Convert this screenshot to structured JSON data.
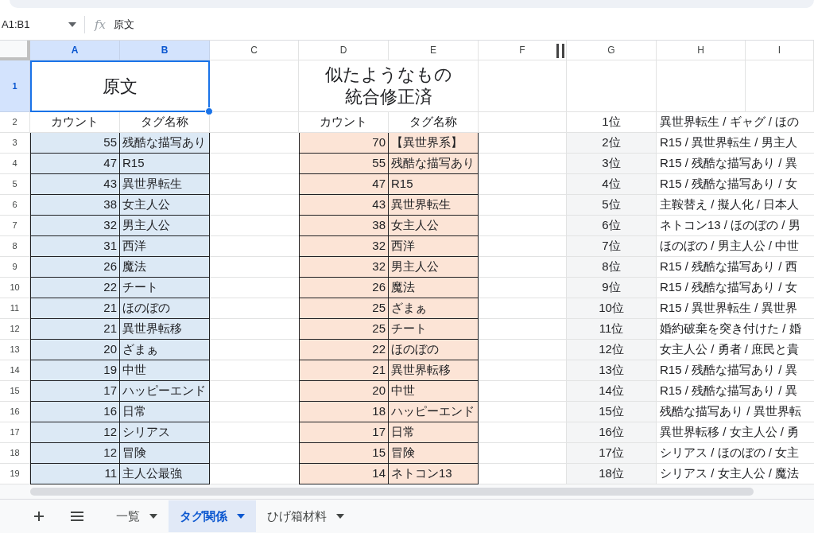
{
  "name_box": "A1:B1",
  "function_label": "fx",
  "formula": "原文",
  "columns": [
    {
      "label": "A",
      "selected": true
    },
    {
      "label": "B",
      "selected": true
    },
    {
      "label": "C",
      "selected": false
    },
    {
      "label": "D",
      "selected": false
    },
    {
      "label": "E",
      "selected": false
    },
    {
      "label": "F",
      "selected": false
    },
    {
      "label": "G",
      "selected": false
    },
    {
      "label": "H",
      "selected": false
    },
    {
      "label": "I",
      "selected": false
    }
  ],
  "row_numbers": [
    {
      "number": "1",
      "selected": true
    },
    {
      "number": "2",
      "selected": false
    },
    {
      "number": "3",
      "selected": false
    },
    {
      "number": "4",
      "selected": false
    },
    {
      "number": "5",
      "selected": false
    },
    {
      "number": "6",
      "selected": false
    },
    {
      "number": "7",
      "selected": false
    },
    {
      "number": "8",
      "selected": false
    },
    {
      "number": "9",
      "selected": false
    },
    {
      "number": "10",
      "selected": false
    },
    {
      "number": "11",
      "selected": false
    },
    {
      "number": "12",
      "selected": false
    },
    {
      "number": "13",
      "selected": false
    },
    {
      "number": "14",
      "selected": false
    },
    {
      "number": "15",
      "selected": false
    },
    {
      "number": "16",
      "selected": false
    },
    {
      "number": "17",
      "selected": false
    },
    {
      "number": "18",
      "selected": false
    },
    {
      "number": "19",
      "selected": false
    }
  ],
  "left_table": {
    "title": "原文",
    "headers": [
      "カウント",
      "タグ名称"
    ],
    "rows": [
      {
        "count": "55",
        "tag": "残酷な描写あり"
      },
      {
        "count": "47",
        "tag": "R15"
      },
      {
        "count": "43",
        "tag": "異世界転生"
      },
      {
        "count": "38",
        "tag": "女主人公"
      },
      {
        "count": "32",
        "tag": "男主人公"
      },
      {
        "count": "31",
        "tag": "西洋"
      },
      {
        "count": "26",
        "tag": "魔法"
      },
      {
        "count": "22",
        "tag": "チート"
      },
      {
        "count": "21",
        "tag": "ほのぼの"
      },
      {
        "count": "21",
        "tag": "異世界転移"
      },
      {
        "count": "20",
        "tag": "ざまぁ"
      },
      {
        "count": "19",
        "tag": "中世"
      },
      {
        "count": "17",
        "tag": "ハッピーエンド"
      },
      {
        "count": "16",
        "tag": "日常"
      },
      {
        "count": "12",
        "tag": "シリアス"
      },
      {
        "count": "12",
        "tag": "冒険"
      },
      {
        "count": "11",
        "tag": "主人公最強"
      }
    ]
  },
  "right_table": {
    "title_lines": [
      "似たようなもの",
      "統合修正済"
    ],
    "headers": [
      "カウント",
      "タグ名称"
    ],
    "rows": [
      {
        "count": "70",
        "tag": "【異世界系】"
      },
      {
        "count": "55",
        "tag": "残酷な描写あり"
      },
      {
        "count": "47",
        "tag": "R15"
      },
      {
        "count": "43",
        "tag": "異世界転生"
      },
      {
        "count": "38",
        "tag": "女主人公"
      },
      {
        "count": "32",
        "tag": "西洋"
      },
      {
        "count": "32",
        "tag": "男主人公"
      },
      {
        "count": "26",
        "tag": "魔法"
      },
      {
        "count": "25",
        "tag": "ざまぁ"
      },
      {
        "count": "25",
        "tag": "チート"
      },
      {
        "count": "22",
        "tag": "ほのぼの"
      },
      {
        "count": "21",
        "tag": "異世界転移"
      },
      {
        "count": "20",
        "tag": "中世"
      },
      {
        "count": "18",
        "tag": "ハッピーエンド"
      },
      {
        "count": "17",
        "tag": "日常"
      },
      {
        "count": "15",
        "tag": "冒険"
      },
      {
        "count": "14",
        "tag": "ネトコン13"
      }
    ]
  },
  "ranking": [
    {
      "rank": "1位",
      "tags": "異世界転生 / ギャグ / ほの"
    },
    {
      "rank": "2位",
      "tags": "R15 / 異世界転生 / 男主人"
    },
    {
      "rank": "3位",
      "tags": "R15 / 残酷な描写あり / 異"
    },
    {
      "rank": "4位",
      "tags": "R15 / 残酷な描写あり / 女"
    },
    {
      "rank": "5位",
      "tags": "主鞍替え / 擬人化 / 日本人"
    },
    {
      "rank": "6位",
      "tags": "ネトコン13 / ほのぼの / 男"
    },
    {
      "rank": "7位",
      "tags": "ほのぼの / 男主人公 / 中世"
    },
    {
      "rank": "8位",
      "tags": "R15 / 残酷な描写あり / 西"
    },
    {
      "rank": "9位",
      "tags": "R15 / 残酷な描写あり / 女"
    },
    {
      "rank": "10位",
      "tags": "R15 / 異世界転生 / 異世界"
    },
    {
      "rank": "11位",
      "tags": "婚約破棄を突き付けた / 婚"
    },
    {
      "rank": "12位",
      "tags": "女主人公 / 勇者 / 庶民と貴"
    },
    {
      "rank": "13位",
      "tags": "R15 / 残酷な描写あり / 異"
    },
    {
      "rank": "14位",
      "tags": "R15 / 残酷な描写あり / 異"
    },
    {
      "rank": "15位",
      "tags": "残酷な描写あり / 異世界転"
    },
    {
      "rank": "16位",
      "tags": "異世界転移 / 女主人公 / 勇"
    },
    {
      "rank": "17位",
      "tags": "シリアス / ほのぼの / 女主"
    },
    {
      "rank": "18位",
      "tags": "シリアス / 女主人公 / 魔法"
    }
  ],
  "sheet_tabs": [
    {
      "label": "一覧",
      "selected": false
    },
    {
      "label": "タグ関係",
      "selected": true
    },
    {
      "label": "ひげ箱材料",
      "selected": false
    }
  ]
}
